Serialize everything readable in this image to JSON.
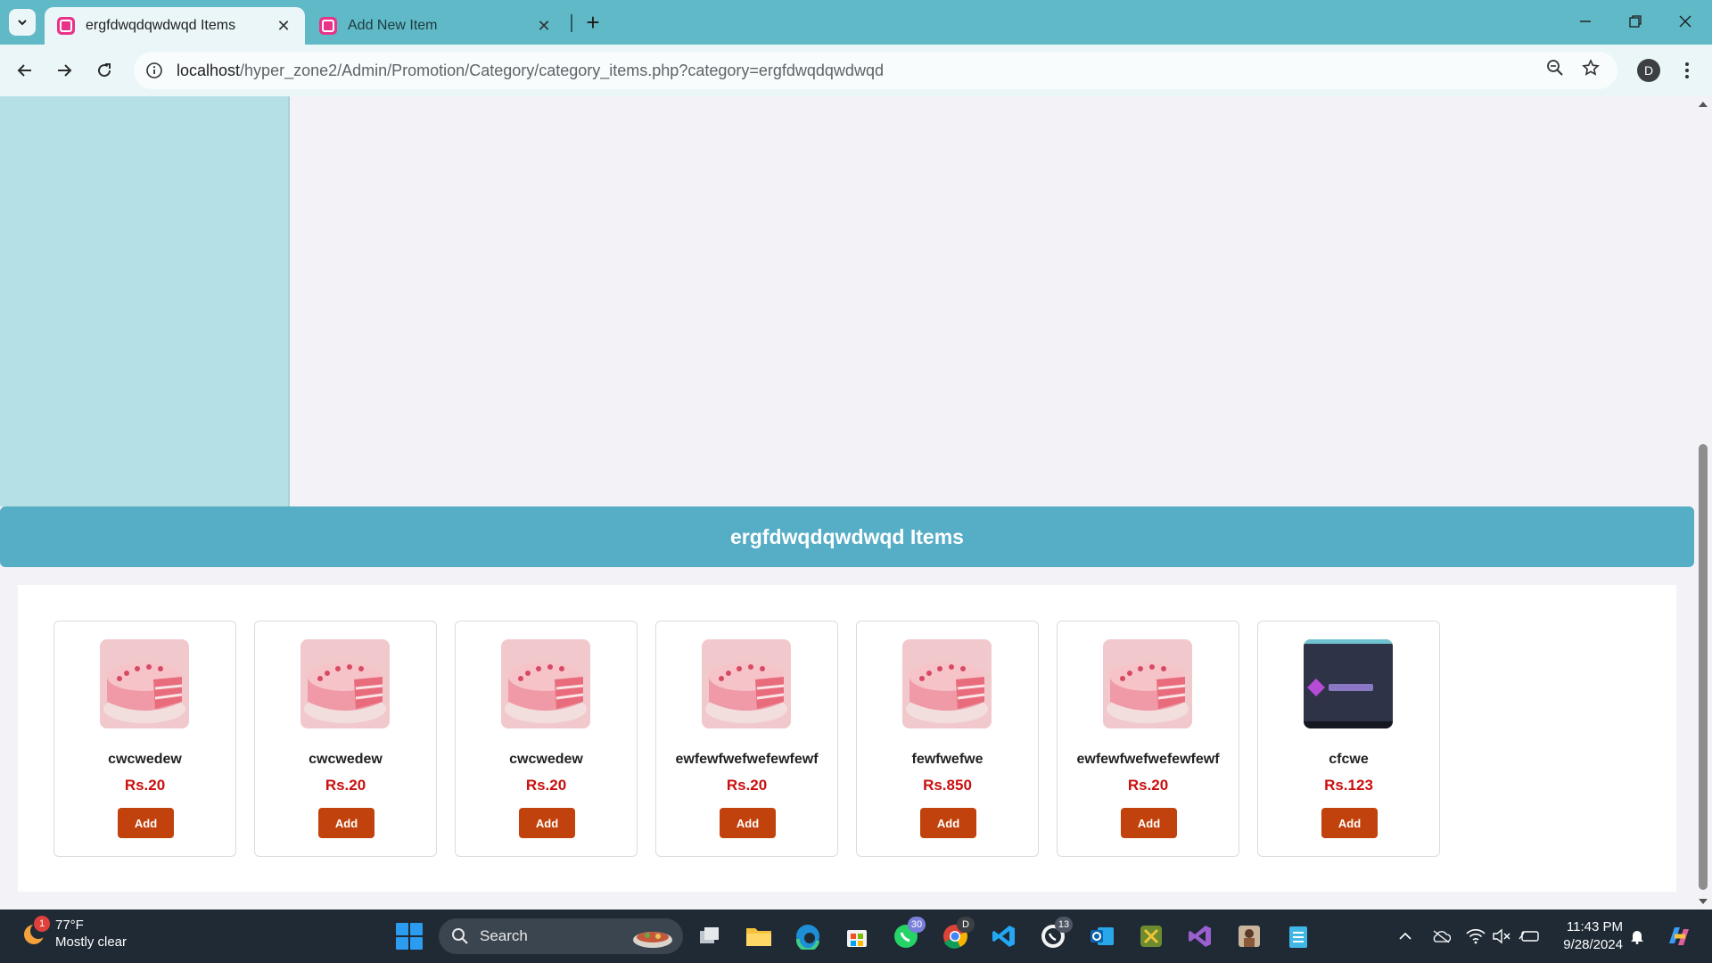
{
  "browser": {
    "tabs": [
      {
        "title": "ergfdwqdqwdwqd Items",
        "active": true
      },
      {
        "title": "Add New Item",
        "active": false
      }
    ],
    "url_host": "localhost",
    "url_path": "/hyper_zone2/Admin/Promotion/Category/category_items.php?category=ergfdwqdqwdwqd",
    "profile_initial": "D"
  },
  "page": {
    "heading": "ergfdwqdqwdwqd Items",
    "add_label": "Add",
    "items": [
      {
        "name": "cwcwedew",
        "price": "Rs.20",
        "image": "cake"
      },
      {
        "name": "cwcwedew",
        "price": "Rs.20",
        "image": "cake"
      },
      {
        "name": "cwcwedew",
        "price": "Rs.20",
        "image": "cake"
      },
      {
        "name": "ewfewfwefwefewfewf",
        "price": "Rs.20",
        "image": "cake"
      },
      {
        "name": "fewfwefwe",
        "price": "Rs.850",
        "image": "cake"
      },
      {
        "name": "ewfewfwefwefewfewf",
        "price": "Rs.20",
        "image": "cake"
      },
      {
        "name": "cfcwe",
        "price": "Rs.123",
        "image": "screenshot"
      }
    ]
  },
  "taskbar": {
    "weather_temp": "77°F",
    "weather_desc": "Mostly clear",
    "weather_badge": "1",
    "search_label": "Search",
    "whatsapp_badge": "30",
    "chrome_badge": "D",
    "whatsapp2_badge": "13",
    "time": "11:43 PM",
    "date": "9/28/2024"
  },
  "colors": {
    "tabstrip": "#5fb9c6",
    "sidebar": "#b4e0e6",
    "header_bar": "#56adc6",
    "price": "#c9100f",
    "add_button": "#c1420c"
  }
}
